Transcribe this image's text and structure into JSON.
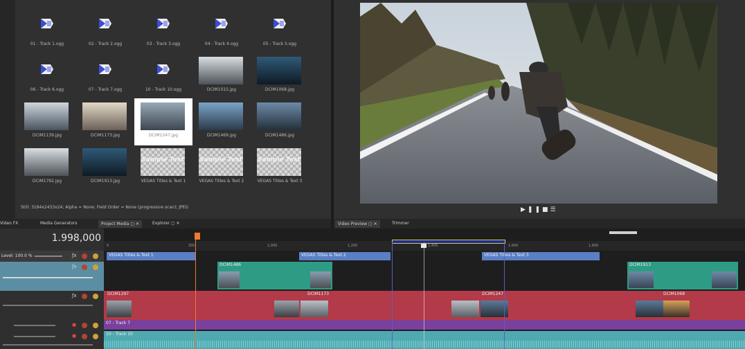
{
  "project_media": {
    "items": [
      {
        "name": "01 - Track 1.ogg",
        "kind": "audio"
      },
      {
        "name": "02 - Track 2.ogg",
        "kind": "audio"
      },
      {
        "name": "03 - Track 3.ogg",
        "kind": "audio"
      },
      {
        "name": "04 - Track 4.ogg",
        "kind": "audio"
      },
      {
        "name": "05 - Track 5.ogg",
        "kind": "audio"
      },
      {
        "name": "06 - Track 6.ogg",
        "kind": "audio"
      },
      {
        "name": "07 - Track 7.ogg",
        "kind": "audio"
      },
      {
        "name": "10 - Track 10.ogg",
        "kind": "audio"
      },
      {
        "name": "DCIM1015.jpg",
        "kind": "image"
      },
      {
        "name": "DCIM1068.jpg",
        "kind": "image"
      },
      {
        "name": "DCIM1139.jpg",
        "kind": "image"
      },
      {
        "name": "DCIM1173.jpg",
        "kind": "image"
      },
      {
        "name": "DCIM1247.jpg",
        "kind": "image",
        "selected": true
      },
      {
        "name": "DCIM1469.jpg",
        "kind": "image"
      },
      {
        "name": "DCIM1486.jpg",
        "kind": "image"
      },
      {
        "name": "DCIM1792.jpg",
        "kind": "image"
      },
      {
        "name": "DCIM1913.jpg",
        "kind": "image"
      },
      {
        "name": "VEGAS Titles & Text 1",
        "kind": "title",
        "sample": "Sample Text"
      },
      {
        "name": "VEGAS Titles & Text 2",
        "kind": "title",
        "sample": "Sample Text"
      },
      {
        "name": "VEGAS Titles & Text 3",
        "kind": "title",
        "sample": "Sample Text"
      }
    ],
    "status": "Still: 3184x2433x24; Alpha = None; Field Order = None (progressive scan); JPEG"
  },
  "left_tabs": {
    "video_fx": "Video FX",
    "media_generators": "Media Generators",
    "project_media": "Project Media",
    "explorer": "Explorer"
  },
  "right_tabs": {
    "video_preview": "Video Preview",
    "trimmer": "Trimmer"
  },
  "transport": {
    "play": "▶",
    "pause": "❚❚",
    "stop": "■",
    "menu": "☰"
  },
  "timeline": {
    "timecode": "1.998,000",
    "level_label": "Level: 100.0 %",
    "ruler_ticks": [
      "0",
      "200",
      "1,000",
      "1,200",
      "1,400",
      "1,600",
      "1,800"
    ],
    "title_clips": [
      "VEGAS Titles & Text 1",
      "VEGAS Titles & Text 2",
      "VEGAS Titles & Text 3"
    ],
    "video_clips_track2": [
      "DCIM1486",
      "DCIM1913"
    ],
    "video_clips_track3": [
      "DCIM1297",
      "DCIM1173",
      "DCIM1247",
      "DCIM1068"
    ],
    "audio_track_1": "07 - Track 7",
    "audio_track_2": "10 - Track 10"
  },
  "colors": {
    "title_clip": "#5b7fc4",
    "video_clip_green": "#2e9c84",
    "video_clip_red": "#b33a48",
    "audio_purple": "#7b3f9c",
    "audio_teal": "#4fa9b0",
    "loop_region": "#1f2e9c",
    "playhead": "#f07a30"
  }
}
